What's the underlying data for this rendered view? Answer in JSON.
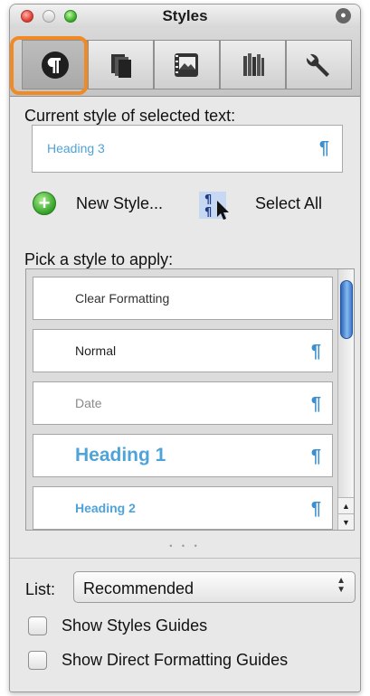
{
  "window": {
    "title": "Styles"
  },
  "toolbar": {
    "tabs": [
      {
        "icon": "paragraph-styles-icon",
        "active": true
      },
      {
        "icon": "pages-icon",
        "active": false
      },
      {
        "icon": "media-icon",
        "active": false
      },
      {
        "icon": "library-icon",
        "active": false
      },
      {
        "icon": "wrench-icon",
        "active": false
      }
    ],
    "highlight_color": "#f08a24"
  },
  "current_style": {
    "label": "Current style of selected text:",
    "value": "Heading 3",
    "pilcrow": "¶"
  },
  "actions": {
    "new_style": "New Style...",
    "select_all": "Select All"
  },
  "styles_list": {
    "label": "Pick a style to apply:",
    "items": [
      {
        "name": "Clear Formatting",
        "color": "#333333",
        "pilcrow": ""
      },
      {
        "name": "Normal",
        "color": "#222222",
        "pilcrow": "¶"
      },
      {
        "name": "Date",
        "color": "#8a8a8a",
        "pilcrow": "¶"
      },
      {
        "name": "Heading 1",
        "color": "#4ea3d9",
        "pilcrow": "¶"
      },
      {
        "name": "Heading 2",
        "color": "#4ea3d9",
        "pilcrow": "¶"
      }
    ],
    "more_indicator": "• • •"
  },
  "list_filter": {
    "label": "List:",
    "value": "Recommended"
  },
  "checkboxes": [
    {
      "label": "Show Styles Guides",
      "checked": false
    },
    {
      "label": "Show Direct Formatting Guides",
      "checked": false
    }
  ]
}
